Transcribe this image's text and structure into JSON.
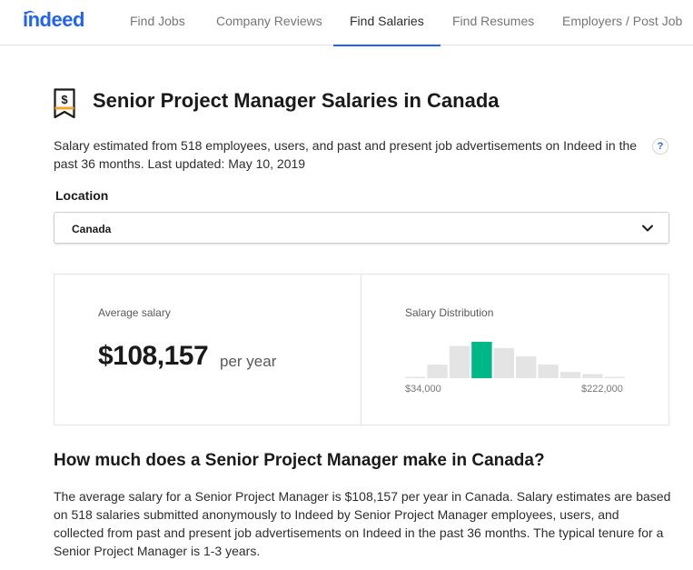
{
  "nav": {
    "logo": "indeed",
    "items": [
      {
        "label": "Find Jobs",
        "active": false
      },
      {
        "label": "Company Reviews",
        "active": false
      },
      {
        "label": "Find Salaries",
        "active": true
      },
      {
        "label": "Find Resumes",
        "active": false
      },
      {
        "label": "Employers / Post Job",
        "active": false
      }
    ]
  },
  "header": {
    "icon": "salary-tag-icon",
    "title": "Senior Project Manager Salaries in Canada",
    "summary": "Salary estimated from 518 employees, users, and past and present job advertisements on Indeed in the past 36 months. Last updated: May 10, 2019",
    "help_label": "?"
  },
  "location": {
    "label": "Location",
    "selected": "Canada"
  },
  "salary": {
    "average_label": "Average salary",
    "average_value": "$108,157",
    "unit": "per year",
    "distribution_label": "Salary Distribution",
    "range_min": "$34,000",
    "range_max": "$222,000"
  },
  "chart_data": {
    "type": "bar",
    "title": "Salary Distribution",
    "values": [
      1,
      13,
      31,
      35,
      29,
      21,
      13,
      6,
      4,
      1
    ],
    "highlighted_index": 3,
    "x_range_labels": [
      "$34,000",
      "$222,000"
    ],
    "colors": {
      "bar": "#e4e4e4",
      "highlight": "#00b887"
    },
    "grid": false
  },
  "section": {
    "heading": "How much does a Senior Project Manager make in Canada?",
    "body": "The average salary for a Senior Project Manager is $108,157 per year in Canada. Salary estimates are based on 518 salaries submitted anonymously to Indeed by Senior Project Manager employees, users, and collected from past and present job advertisements on Indeed in the past 36 months. The typical tenure for a Senior Project Manager is 1-3 years."
  },
  "colors": {
    "brand": "#2164f3",
    "accent_green": "#00b887"
  }
}
